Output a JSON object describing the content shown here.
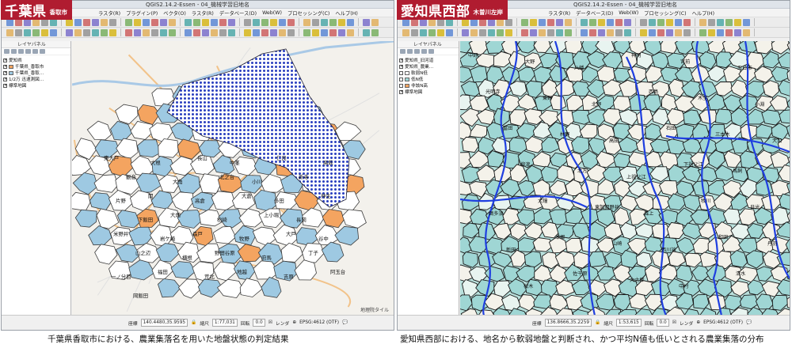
{
  "left": {
    "badge": {
      "big": "千葉県",
      "small": "香取市"
    },
    "window_title": "QGIS2.14.2-Essen - 04_機械学習旧地名",
    "menu": [
      "ラスタ(R)",
      "プラグイン(P)",
      "ベクタ(O)",
      "ラスタ(R)",
      "データベース(D)",
      "Web(W)",
      "プロセッシング(C)",
      "ヘルプ(H)"
    ],
    "layers_header": "レイヤパネル",
    "layers": [
      {
        "label": "愛知県",
        "check": "x",
        "swatch": ""
      },
      {
        "label": "千葉県_香取市",
        "check": "x",
        "swatch": "#f4a460"
      },
      {
        "label": "千葉県_香取…",
        "check": "x",
        "swatch": "#9ec9e2"
      },
      {
        "label": "1/2万 迅速測図…",
        "check": "x",
        "swatch": ""
      },
      {
        "label": "標準地図",
        "check": "x",
        "swatch": ""
      }
    ],
    "status": {
      "coord_label": "座標",
      "coord": "140.4480,35.9595",
      "scale_label": "縮尺",
      "scale": "1:77,031",
      "rot_label": "回転",
      "rot": "0.0",
      "render": "レンダ",
      "crs": "EPSG:4612 (OTF)"
    },
    "attribution": "地理院タイル",
    "caption": "千葉県香取市における、農業集落名を用いた地盤状態の判定結果",
    "labels": [
      "東大戸",
      "大根",
      "長山",
      "中峯",
      "仁良",
      "高萩",
      "観音",
      "大角",
      "北之台",
      "小川",
      "新寺",
      "片野",
      "関",
      "高倉",
      "大倉",
      "多田",
      "神生",
      "下飯田",
      "大畑",
      "松崎",
      "上小堀",
      "長岡",
      "米野井",
      "岩ケ崎",
      "森戸",
      "牧野",
      "大戸",
      "谷中",
      "山之辺",
      "横根",
      "野間谷原",
      "府馬",
      "丁子",
      "一ノ分目",
      "福田",
      "荒北",
      "地越",
      "吉原",
      "阿玉台",
      "岡飯田"
    ]
  },
  "right": {
    "badge": {
      "big": "愛知県西部",
      "small": "木曽川左岸"
    },
    "window_title": "QGIS2.14.2-Essen - 04_機械学習旧地名",
    "menu": [
      "ラスタ(R)",
      "データベース(D)",
      "Web(W)",
      "プロセッシング(C)",
      "ヘルプ(H)"
    ],
    "layers_header": "レイヤパネル",
    "layers": [
      {
        "label": "愛知県_旧河道",
        "check": "x",
        "swatch": ""
      },
      {
        "label": "愛知県_農業…",
        "check": "x",
        "swatch": ""
      },
      {
        "label": "軟弱N低",
        "check": "",
        "swatch": "#ffffff"
      },
      {
        "label": "低N低",
        "check": "",
        "swatch": "#9fd6d4"
      },
      {
        "label": "非該N高",
        "check": "",
        "swatch": "#f4a460"
      },
      {
        "label": "標準地図",
        "check": "x",
        "swatch": ""
      }
    ],
    "status": {
      "coord_label": "座標",
      "coord": "136.8666,35.2259",
      "scale_label": "縮尺",
      "scale": "1:53,615",
      "rot_label": "回転",
      "rot": "0.0",
      "render": "レンダ",
      "crs": "EPSG:4612 (OTF)"
    },
    "caption": "愛知県西部における、地名から軟弱地盤と判断され、かつ平均N値も低いとされる農業集落の分布",
    "labels": [
      "中野",
      "大野",
      "八幡",
      "神明",
      "宮前",
      "五日市",
      "光明寺",
      "東野",
      "北野",
      "西島",
      "木全",
      "小淵",
      "富田",
      "林野",
      "高田",
      "石田",
      "三本木",
      "大口",
      "柳津",
      "北方",
      "上祖父江",
      "下祖父江",
      "馬飼",
      "鵜多須",
      "大鐘",
      "東加賀野井",
      "森上",
      "牧川",
      "日光",
      "新田",
      "本郷",
      "山崎",
      "西川端",
      "和田",
      "丹羽",
      "桜木",
      "佐千原",
      "大之郷",
      "中村",
      "清水"
    ]
  },
  "colors": {
    "badge": "#b01c30",
    "orange": "#f4a460",
    "blue": "#9ec9e2",
    "teal": "#9fd6d4",
    "hatch": "#2a3fbf",
    "river": "#1f3fe0"
  }
}
